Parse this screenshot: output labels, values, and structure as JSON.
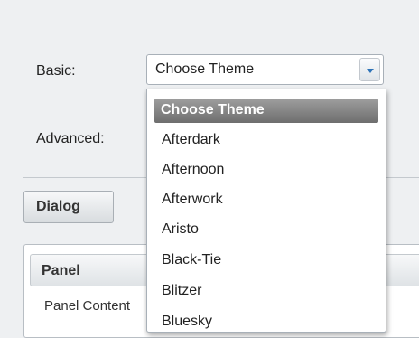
{
  "form": {
    "basic_label": "Basic:",
    "advanced_label": "Advanced:"
  },
  "theme_select": {
    "value": "Choose Theme",
    "options": [
      "Choose Theme",
      "Afterdark",
      "Afternoon",
      "Afterwork",
      "Aristo",
      "Black-Tie",
      "Blitzer",
      "Bluesky"
    ],
    "selected_index": 0
  },
  "dialog_button": {
    "label": "Dialog"
  },
  "panel": {
    "title": "Panel",
    "content": "Panel Content"
  },
  "colors": {
    "background": "#eef0f2",
    "selected_option": "#7f7f7f",
    "arrow": "#2e73b8"
  },
  "icons": {
    "dropdown_trigger": "triangle-down-icon"
  }
}
